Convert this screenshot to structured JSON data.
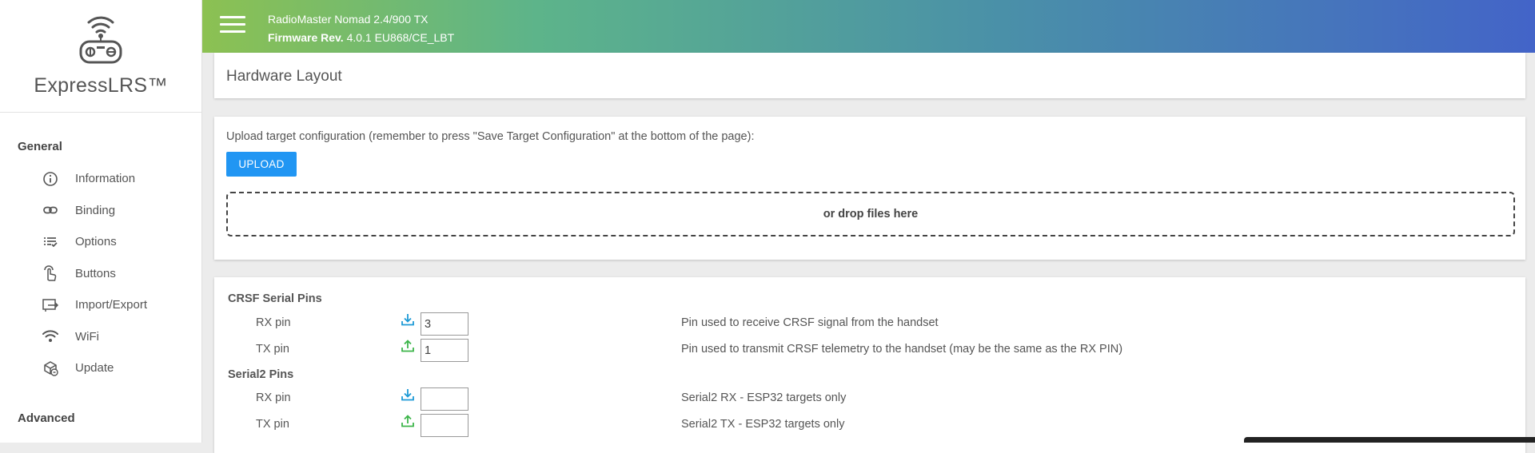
{
  "sidebar": {
    "brand": "ExpressLRS™",
    "general_heading": "General",
    "advanced_heading": "Advanced",
    "items": [
      {
        "label": "Information",
        "icon": "info-icon"
      },
      {
        "label": "Binding",
        "icon": "link-icon"
      },
      {
        "label": "Options",
        "icon": "list-check-icon"
      },
      {
        "label": "Buttons",
        "icon": "hand-pointer-icon"
      },
      {
        "label": "Import/Export",
        "icon": "import-export-icon"
      },
      {
        "label": "WiFi",
        "icon": "wifi-icon"
      },
      {
        "label": "Update",
        "icon": "package-update-icon"
      }
    ]
  },
  "header": {
    "device": "RadioMaster Nomad 2.4/900 TX",
    "firmware_label": "Firmware Rev.",
    "firmware_value": "4.0.1 EU868/CE_LBT"
  },
  "page": {
    "title": "Hardware Layout"
  },
  "upload": {
    "text": "Upload target configuration (remember to press \"Save Target Configuration\" at the bottom of the page):",
    "button_label": "UPLOAD",
    "dropzone_label": "or drop files here"
  },
  "pins": {
    "crsf_title": "CRSF Serial Pins",
    "crsf_rx_label": "RX pin",
    "crsf_rx_value": "3",
    "crsf_rx_desc": "Pin used to receive CRSF signal from the handset",
    "crsf_tx_label": "TX pin",
    "crsf_tx_value": "1",
    "crsf_tx_desc": "Pin used to transmit CRSF telemetry to the handset (may be the same as the RX PIN)",
    "serial2_title": "Serial2 Pins",
    "serial2_rx_label": "RX pin",
    "serial2_rx_value": "",
    "serial2_rx_desc": "Serial2 RX - ESP32 targets only",
    "serial2_tx_label": "TX pin",
    "serial2_tx_value": "",
    "serial2_tx_desc": "Serial2 TX - ESP32 targets only"
  },
  "colors": {
    "accent": "#2196f3",
    "rx_icon": "#1e9ad6",
    "tx_icon": "#3cb54a"
  }
}
